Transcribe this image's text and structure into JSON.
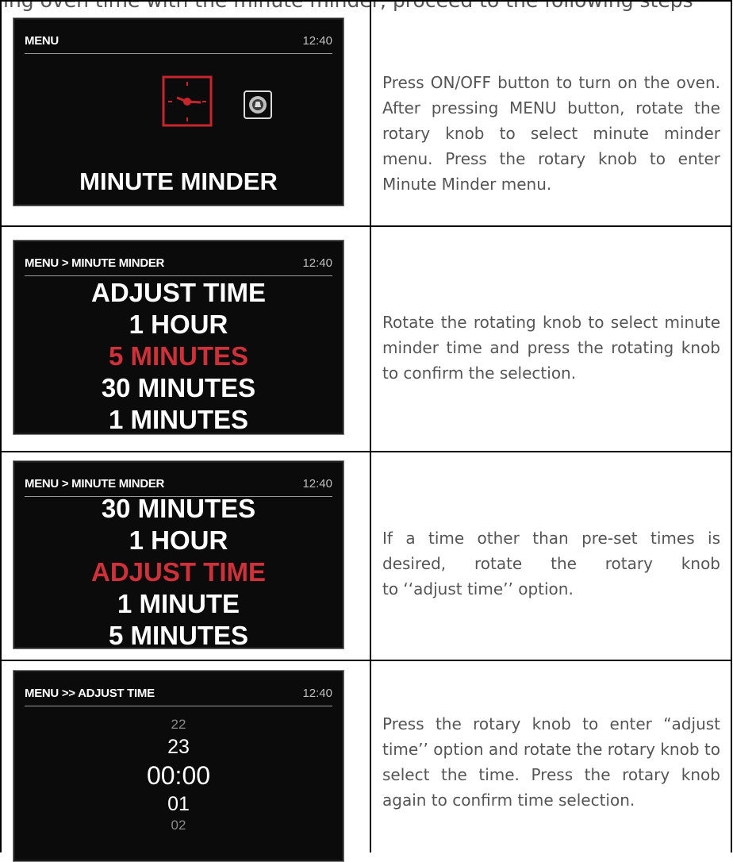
{
  "intro_text": "ing oven time with the minute minder, proceed to the following steps",
  "steps": [
    {
      "screen": {
        "path": "MENU",
        "time": "12:40",
        "caption": "MINUTE MINDER",
        "icons": [
          "clock-icon",
          "alarm-bell-icon"
        ]
      },
      "description": "Press ON/OFF button to turn on the oven. After pressing MENU button, rotate the rotary knob to select minute minder menu. Press the rotary knob to enter Minute Minder menu."
    },
    {
      "screen": {
        "path": "MENU > MINUTE MINDER",
        "time": "12:40",
        "items": [
          "ADJUST TIME",
          "1 HOUR",
          "5 MINUTES",
          "30 MINUTES",
          "1 MINUTES"
        ],
        "selected": "5 MINUTES"
      },
      "description": "Rotate the rotating knob to select minute minder time and press the rotating knob to confirm the selection."
    },
    {
      "screen": {
        "path": "MENU > MINUTE MINDER",
        "time": "12:40",
        "items": [
          "30 MINUTES",
          "1 HOUR",
          "ADJUST TIME",
          "1 MINUTE",
          "5 MINUTES"
        ],
        "selected": "ADJUST TIME"
      },
      "description_lines": [
        "If a time other than pre-set times is desired, rotate the rotary knob",
        "to ‘‘adjust time’’ option."
      ]
    },
    {
      "screen": {
        "path": "MENU >> ADJUST TIME",
        "time": "12:40",
        "values": [
          "22",
          "23",
          "00:00",
          "01",
          "02"
        ]
      },
      "description": "Press the rotary knob to enter “adjust time’’ option and rotate the rotary knob to select the time. Press the rotary knob again to confirm time selection."
    }
  ],
  "colors": {
    "screen_bg": "#0b0b0b",
    "selected": "#d0303a",
    "text": "#555555"
  }
}
